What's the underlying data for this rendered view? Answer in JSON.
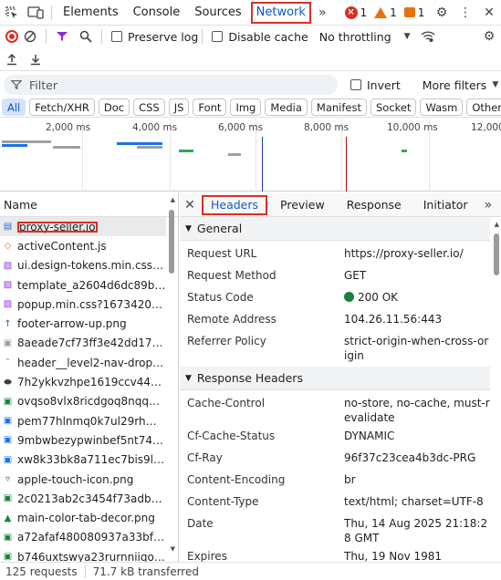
{
  "top_tabs": [
    "Elements",
    "Console",
    "Sources",
    "Network"
  ],
  "active_tab": "Network",
  "issue_counts": {
    "errors": "1",
    "warnings": "1",
    "info": "1"
  },
  "toolbar": {
    "preserve_log": "Preserve log",
    "disable_cache": "Disable cache",
    "throttling": "No throttling"
  },
  "filter": {
    "placeholder": "Filter",
    "invert": "Invert",
    "more_filters": "More filters"
  },
  "type_chips": [
    "All",
    "Fetch/XHR",
    "Doc",
    "CSS",
    "JS",
    "Font",
    "Img",
    "Media",
    "Manifest",
    "Socket",
    "Wasm",
    "Other"
  ],
  "timeline_ticks": [
    "2,000 ms",
    "4,000 ms",
    "6,000 ms",
    "8,000 ms",
    "10,000 ms",
    "12,000"
  ],
  "request_list": {
    "header": "Name",
    "items": [
      {
        "name": "proxy-seller.io",
        "icon": "document-icon",
        "color": "#1a73e8"
      },
      {
        "name": "activeContent.js",
        "icon": "script-icon",
        "color": "#e8710a"
      },
      {
        "name": "ui.design-tokens.min.css?17...",
        "icon": "stylesheet-icon",
        "color": "#9334e6"
      },
      {
        "name": "template_a2604d6dc89b07...",
        "icon": "stylesheet-icon",
        "color": "#9334e6"
      },
      {
        "name": "popup.min.css?1673420807...",
        "icon": "stylesheet-icon",
        "color": "#9334e6"
      },
      {
        "name": "footer-arrow-up.png",
        "icon": "up-arrow-image-icon",
        "color": "#188038"
      },
      {
        "name": "8aeade7cf73ff3e42dd17f46...",
        "icon": "image-icon",
        "color": "#9aa0a6"
      },
      {
        "name": "header__level2-nav-drop-de...",
        "icon": "chevron-image-icon",
        "color": "#9aa0a6"
      },
      {
        "name": "7h2ykkvzhpe1619ccv44m5ft...",
        "icon": "ellipse-image-icon",
        "color": "#3c4043"
      },
      {
        "name": "ovqso8vlx8ricdgoq8nqq3e0...",
        "icon": "badge-image-icon",
        "color": "#188038"
      },
      {
        "name": "pem77hlnmq0k7ul29rhmm...",
        "icon": "python-logo-icon",
        "color": "#1a73e8"
      },
      {
        "name": "9mbwbezypwinbef5nt7414...",
        "icon": "wifi-image-icon",
        "color": "#1a73e8"
      },
      {
        "name": "xw8k33bk8a711ec7bis9l9ml...",
        "icon": "world-image-icon",
        "color": "#1a73e8"
      },
      {
        "name": "apple-touch-icon.png",
        "icon": "shield-image-icon",
        "color": "#188038"
      },
      {
        "name": "2c0213ab2c3454f73adb509...",
        "icon": "image-icon",
        "color": "#188038"
      },
      {
        "name": "main-color-tab-decor.png",
        "icon": "triangle-image-icon",
        "color": "#188038"
      },
      {
        "name": "a72afaf480080937a33bf814...",
        "icon": "image-icon",
        "color": "#188038"
      },
      {
        "name": "b746uxtswya23rurnniiqo4z7...",
        "icon": "image-icon",
        "color": "#188038"
      }
    ]
  },
  "status": {
    "requests": "125 requests",
    "transferred": "71.7 kB transferred"
  },
  "details": {
    "tabs": [
      "Headers",
      "Preview",
      "Response",
      "Initiator"
    ],
    "active_tab": "Headers",
    "general_title": "General",
    "general": [
      {
        "key": "Request URL",
        "value": "https://proxy-seller.io/"
      },
      {
        "key": "Request Method",
        "value": "GET"
      },
      {
        "key": "Status Code",
        "value": "200 OK"
      },
      {
        "key": "Remote Address",
        "value": "104.26.11.56:443"
      },
      {
        "key": "Referrer Policy",
        "value": "strict-origin-when-cross-origin"
      }
    ],
    "response_title": "Response Headers",
    "response_headers": [
      {
        "key": "Cache-Control",
        "value": "no-store, no-cache, must-revalidate"
      },
      {
        "key": "Cf-Cache-Status",
        "value": "DYNAMIC"
      },
      {
        "key": "Cf-Ray",
        "value": "96f37c23cea4b3dc-PRG"
      },
      {
        "key": "Content-Encoding",
        "value": "br"
      },
      {
        "key": "Content-Type",
        "value": "text/html; charset=UTF-8"
      },
      {
        "key": "Date",
        "value": "Thu, 14 Aug 2025 21:18:28 GMT"
      },
      {
        "key": "Expires",
        "value": "Thu, 19 Nov 1981"
      }
    ]
  },
  "colors": {
    "accent": "#0b57d0",
    "highlight_box": "#d93025",
    "status_ok": "#188038"
  }
}
